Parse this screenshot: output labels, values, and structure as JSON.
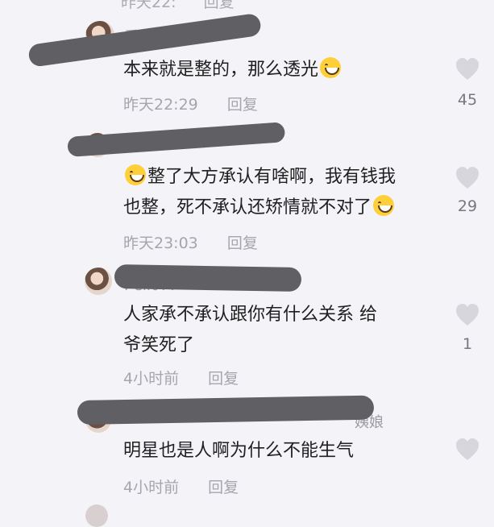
{
  "cutoff_top": {
    "time": "昨天22:",
    "reply": "回复"
  },
  "comments": [
    {
      "username": "看",
      "text_lines": [
        "本来就是整的，那么透光"
      ],
      "emoji_after": "grinning-face-emoji",
      "time": "昨天22:29",
      "reply": "回复",
      "likes": "45"
    },
    {
      "username": "",
      "text_lines": [
        "整了大方承认有啥啊，我有钱我",
        "也整，死不承认还矫情就不对了"
      ],
      "emoji_before": "rolling-laughing-emoji",
      "emoji_after": "rolling-laughing-emoji",
      "time": "昨天23:03",
      "reply": "回复",
      "likes": "29"
    },
    {
      "username": "I-ell077",
      "text_lines": [
        "人家承不承认跟你有什么关系 给",
        "爷笑死了"
      ],
      "time": "4小时前",
      "reply": "回复",
      "likes": "1"
    },
    {
      "username": "姨娘",
      "text_lines": [
        "明星也是人啊为什么不能生气"
      ],
      "time": "4小时前",
      "reply": "回复",
      "likes": ""
    }
  ],
  "colors": {
    "background": "#f4f3f8",
    "redaction": "#5f5f64",
    "meta": "#a5a5ad",
    "heart": "#d7d6dc"
  }
}
